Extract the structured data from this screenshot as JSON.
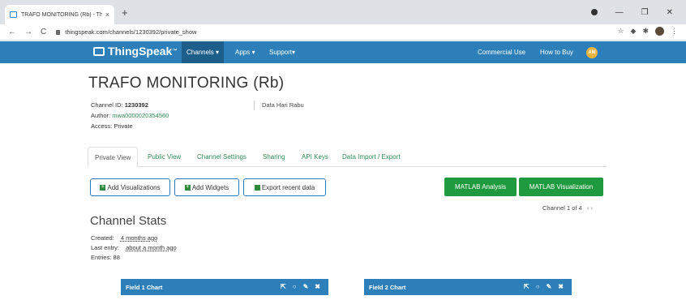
{
  "browser": {
    "tab_title": "TRAFO MONITORING (Rb) - Thin",
    "tab_close": "×",
    "new_tab": "+",
    "url": "thingspeak.com/channels/1230392/private_show",
    "back": "←",
    "forward": "→",
    "reload": "C"
  },
  "navbar": {
    "brand": "ThingSpeak",
    "brand_tm": "™",
    "channels": "Channels ▾",
    "apps": "Apps ▾",
    "support": "Support▾",
    "commercial": "Commercial Use",
    "how_to_buy": "How to Buy",
    "avatar": "AM"
  },
  "channel": {
    "title": "TRAFO MONITORING (Rb)",
    "id_label": "Channel ID:",
    "id_value": "1230392",
    "author_label": "Author:",
    "author_value": "mwa0000020354560",
    "access_label": "Access:",
    "access_value": "Private",
    "description": "Data Hari Rabu"
  },
  "tabs": [
    "Private View",
    "Public View",
    "Channel Settings",
    "Sharing",
    "API Keys",
    "Data Import / Export"
  ],
  "buttons": {
    "add_viz": "Add Visualizations",
    "add_widgets": "Add Widgets",
    "export": "Export recent data",
    "matlab_analysis": "MATLAB Analysis",
    "matlab_viz": "MATLAB Visualization"
  },
  "pager": {
    "label": "Channel 1 of 4",
    "arrows": "‹ ›"
  },
  "stats": {
    "title": "Channel Stats",
    "created_label": "Created:",
    "created_value": "4 months ago",
    "last_label": "Last entry:",
    "last_value": "about a month ago",
    "entries_label": "Entries:",
    "entries_value": "88"
  },
  "charts": [
    {
      "title": "Field 1 Chart"
    },
    {
      "title": "Field 2 Chart"
    }
  ],
  "colors": {
    "navbar": "#2c7fb8",
    "green_button": "#1f9a3e",
    "link": "#2e8b57"
  }
}
